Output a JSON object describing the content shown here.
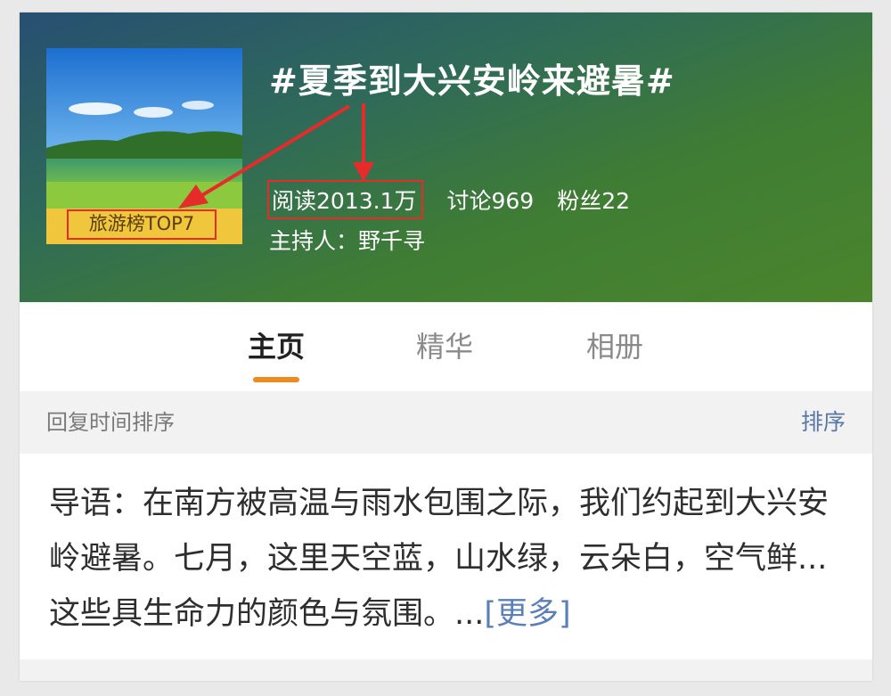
{
  "topic": {
    "title": "#夏季到大兴安岭来避暑#",
    "rank_badge": "旅游榜TOP7",
    "stats": {
      "reads": "阅读2013.1万",
      "discussions": "讨论969",
      "followers": "粉丝22"
    },
    "host": "主持人：野千寻"
  },
  "tabs": [
    {
      "label": "主页",
      "active": true
    },
    {
      "label": "精华",
      "active": false
    },
    {
      "label": "相册",
      "active": false
    }
  ],
  "sortbar": {
    "label": "回复时间排序",
    "button": "排序"
  },
  "intro": {
    "text": "导语：在南方被高温与雨水包围之际，我们约起到大兴安岭避暑。七月，这里天空蓝，山水绿，云朵白，空气鲜...这些具生命力的颜色与氛围。...",
    "more": "[更多]"
  },
  "colors": {
    "accent_tab": "#f08a1c",
    "annotation_red": "#e62b2b",
    "link_blue": "#5b7fb8"
  }
}
